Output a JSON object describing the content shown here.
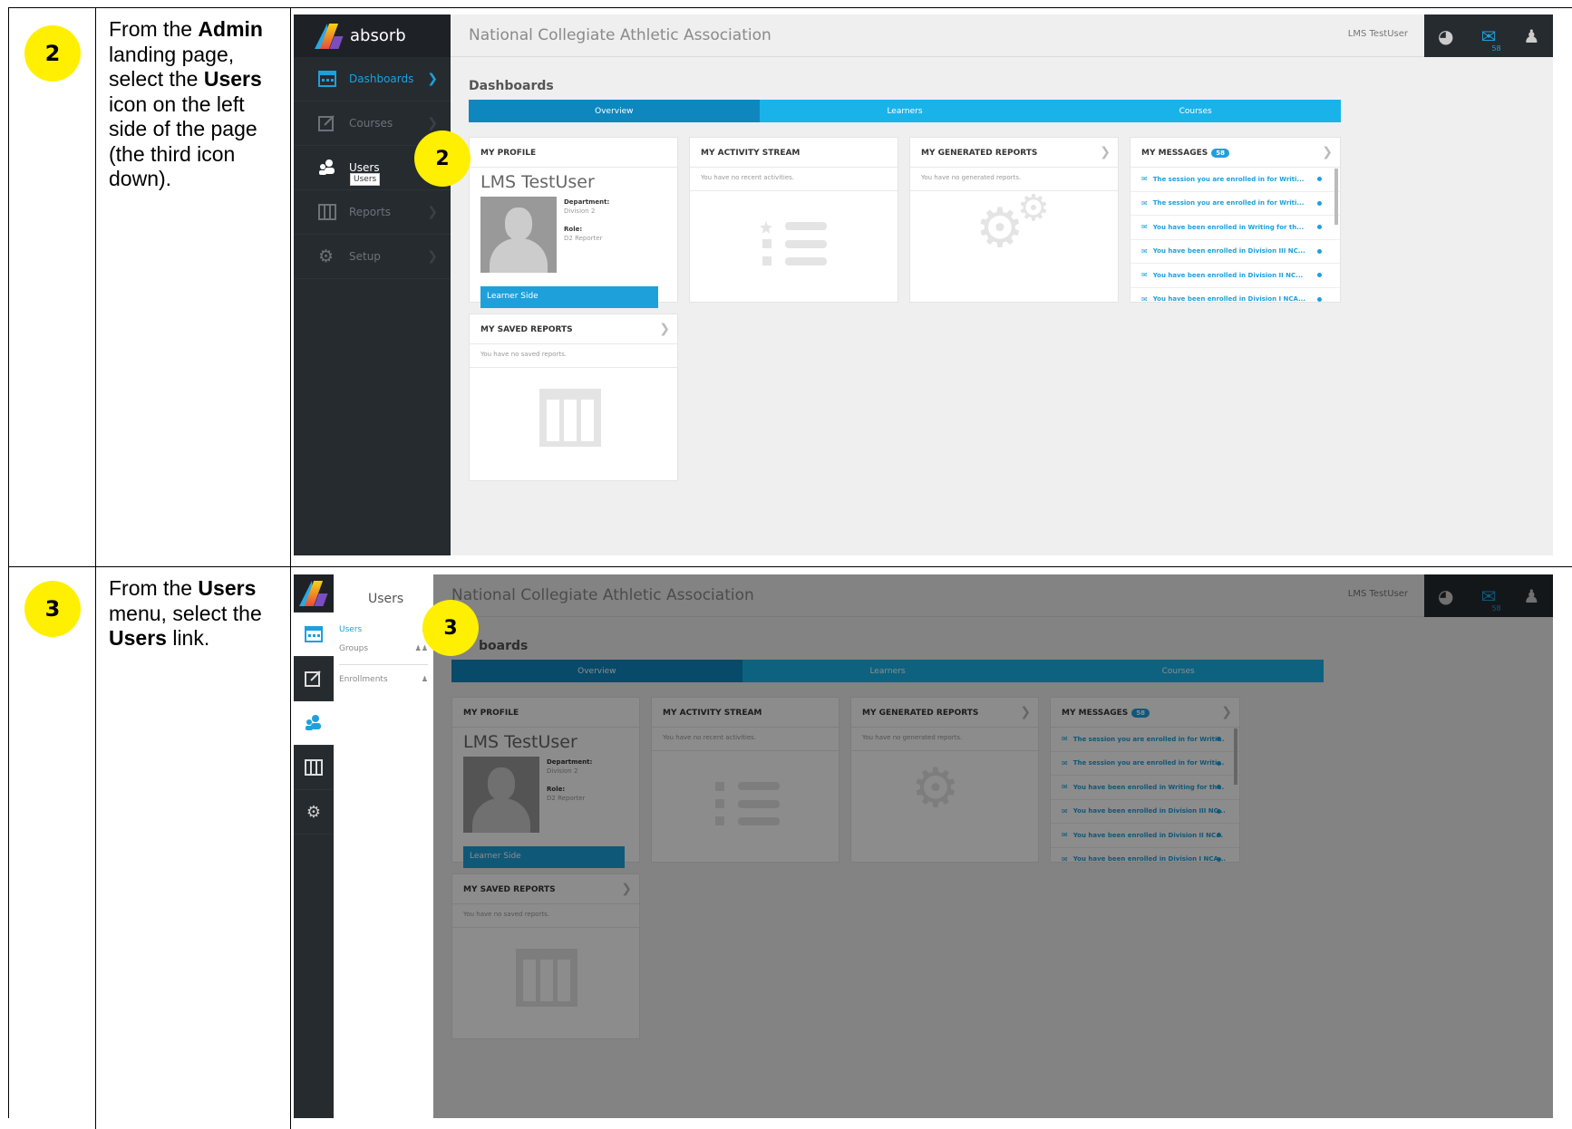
{
  "steps": [
    {
      "number": "2",
      "instruction_parts": [
        "From the ",
        "Admin",
        " landing page, select the ",
        "Users",
        " icon on the left side of the page (the third icon down)."
      ]
    },
    {
      "number": "3",
      "instruction_parts": [
        "From the ",
        "Users",
        " menu, select the ",
        "Users",
        " link."
      ]
    }
  ],
  "app": {
    "logo_text": "absorb",
    "org_name": "National Collegiate Athletic Association",
    "user_name": "LMS TestUser",
    "message_count": "58",
    "page_title": "Dashboards",
    "page_title_partial": "boards",
    "nav": [
      {
        "label": "Dashboards",
        "icon": "dashboard-icon"
      },
      {
        "label": "Courses",
        "icon": "courses-icon"
      },
      {
        "label": "Users",
        "icon": "users-icon"
      },
      {
        "label": "Reports",
        "icon": "reports-icon"
      },
      {
        "label": "Setup",
        "icon": "gear-icon"
      }
    ],
    "tooltip": "Users",
    "tabs": [
      "Overview",
      "Learners",
      "Courses"
    ],
    "cards": {
      "profile": {
        "title": "MY PROFILE",
        "name": "LMS TestUser",
        "dept_label": "Department:",
        "dept_value": "Division 2",
        "role_label": "Role:",
        "role_value": "D2 Reporter",
        "button": "Learner Side"
      },
      "activity": {
        "title": "MY ACTIVITY STREAM",
        "empty": "You have no recent activities."
      },
      "generated": {
        "title": "MY GENERATED REPORTS",
        "empty": "You have no generated reports."
      },
      "messages": {
        "title": "MY MESSAGES",
        "badge": "58",
        "items": [
          "The session you are enrolled in for Writi...",
          "The session you are enrolled in for Writi...",
          "You have been enrolled in Writing for th...",
          "You have been enrolled in Division III NC...",
          "You have been enrolled in Division II NC...",
          "You have been enrolled in Division I NCA..."
        ]
      },
      "saved": {
        "title": "MY SAVED REPORTS",
        "empty": "You have no saved reports."
      }
    },
    "users_menu": {
      "title": "Users",
      "items": [
        "Users",
        "Groups",
        "Enrollments"
      ]
    }
  },
  "colors": {
    "callout": "#ffef00",
    "accent": "#1ea0db",
    "sidebar": "#262b30",
    "tab": "#19b3ea",
    "tab_active": "#0e87bf"
  }
}
